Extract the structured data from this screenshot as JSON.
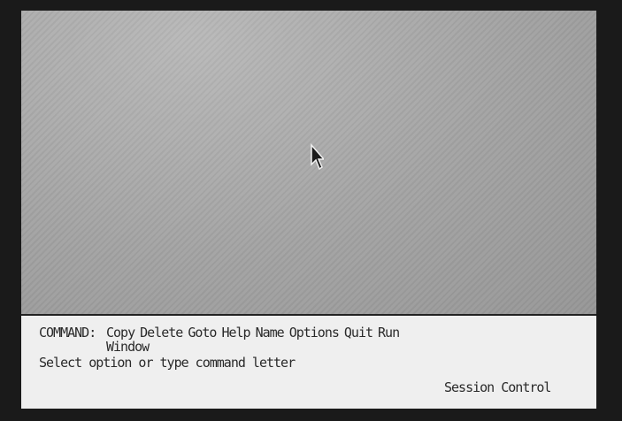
{
  "command_bar": {
    "label": "COMMAND:",
    "options": [
      "Copy",
      "Delete",
      "Goto",
      "Help",
      "Name",
      "Options",
      "Quit",
      "Run"
    ],
    "wrapped_option": "Window",
    "prompt": "Select option or type command letter",
    "mode": "Session Control"
  },
  "cursor": {
    "icon": "arrow-pointer-icon"
  },
  "colors": {
    "bezel": "#1a1a1a",
    "workspace": "#a8a8a8",
    "panel": "#efefef",
    "text": "#2a2a2a"
  }
}
